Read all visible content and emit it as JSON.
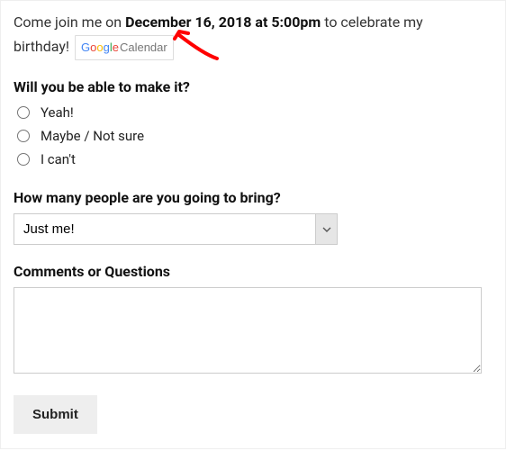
{
  "intro": {
    "prefix": "Come join me on ",
    "date": "December 16, 2018 at 5:00pm",
    "suffix1": " to celebrate my ",
    "suffix2": "birthday! "
  },
  "gcal": {
    "g": "G",
    "o1": "o",
    "o2": "o",
    "g2": "g",
    "l": "l",
    "e": "e",
    "calendar": "Calendar"
  },
  "q1": {
    "label": "Will you be able to make it?",
    "options": [
      "Yeah!",
      "Maybe / Not sure",
      "I can't"
    ]
  },
  "q2": {
    "label": "How many people are you going to bring?",
    "selected": "Just me!"
  },
  "q3": {
    "label": "Comments or Questions"
  },
  "submit": "Submit"
}
